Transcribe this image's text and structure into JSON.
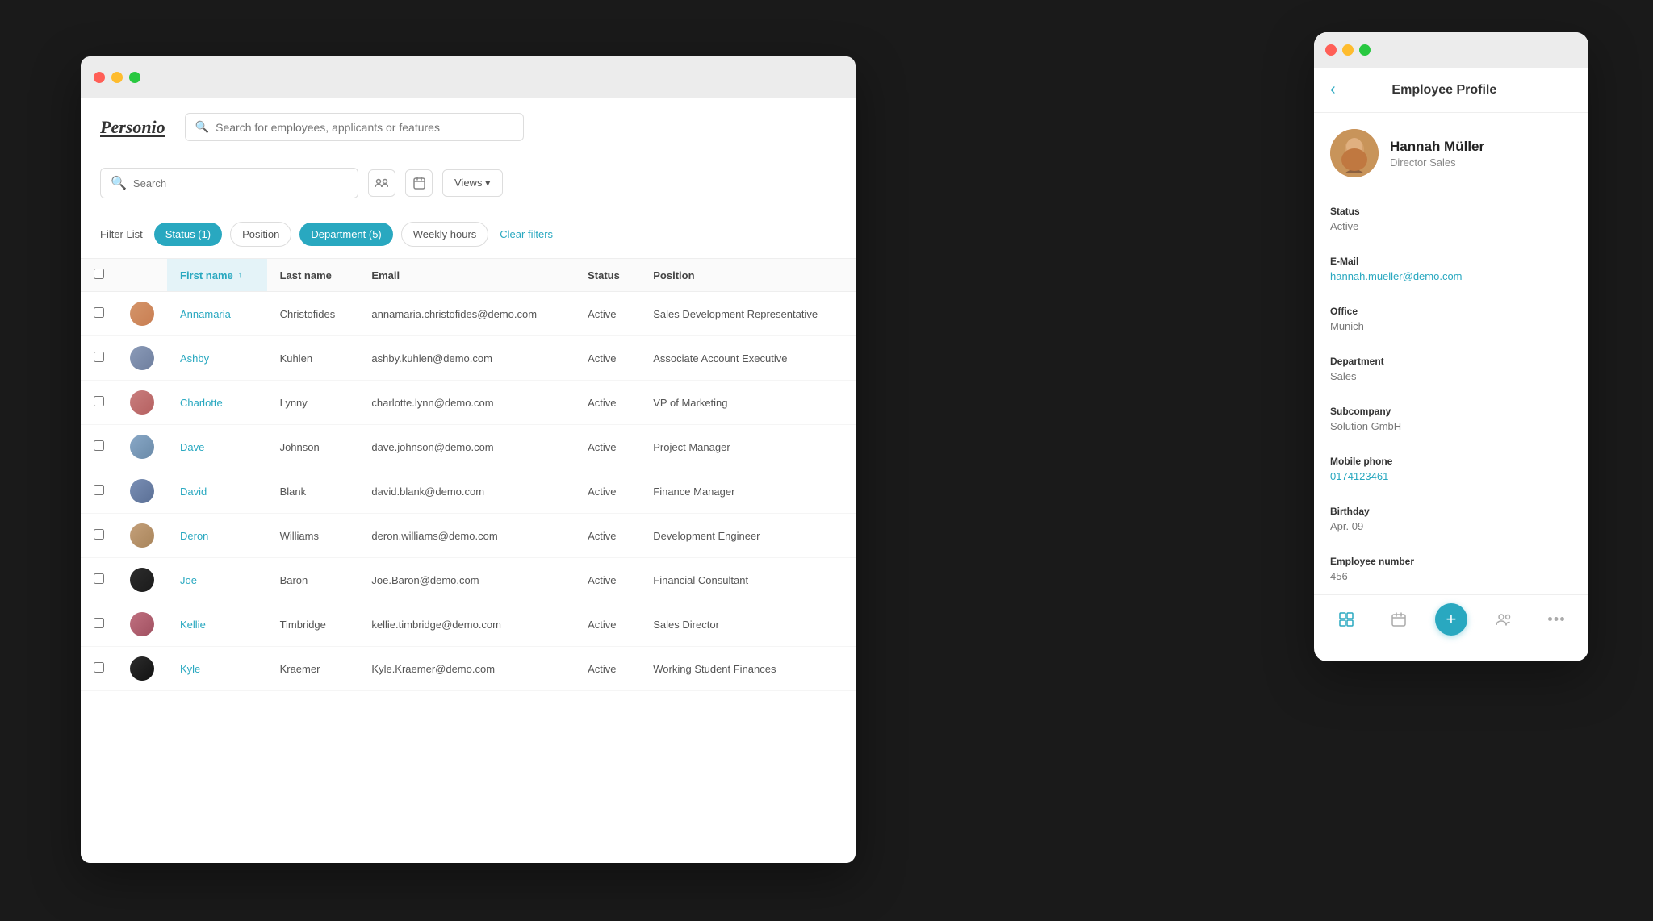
{
  "app": {
    "title": "Personio"
  },
  "global_search": {
    "placeholder": "Search for employees, applicants or features"
  },
  "toolbar": {
    "search_placeholder": "Search",
    "views_label": "Views ▾"
  },
  "filter_bar": {
    "label": "Filter List",
    "filters": [
      {
        "id": "status",
        "label": "Status (1)",
        "active": true
      },
      {
        "id": "position",
        "label": "Position",
        "active": false
      },
      {
        "id": "department",
        "label": "Department (5)",
        "active": true
      },
      {
        "id": "weekly_hours",
        "label": "Weekly hours",
        "active": false
      }
    ],
    "clear_label": "Clear filters"
  },
  "table": {
    "columns": [
      "",
      "",
      "First name",
      "Last name",
      "Email",
      "Status",
      "Position"
    ],
    "rows": [
      {
        "id": 1,
        "avatar_class": "avatar-1",
        "first_name": "Annamaria",
        "last_name": "Christofides",
        "email": "annamaria.christofides@demo.com",
        "status": "Active",
        "position": "Sales Development Representative"
      },
      {
        "id": 2,
        "avatar_class": "avatar-2",
        "first_name": "Ashby",
        "last_name": "Kuhlen",
        "email": "ashby.kuhlen@demo.com",
        "status": "Active",
        "position": "Associate Account Executive"
      },
      {
        "id": 3,
        "avatar_class": "avatar-3",
        "first_name": "Charlotte",
        "last_name": "Lynny",
        "email": "charlotte.lynn@demo.com",
        "status": "Active",
        "position": "VP of Marketing"
      },
      {
        "id": 4,
        "avatar_class": "avatar-4",
        "first_name": "Dave",
        "last_name": "Johnson",
        "email": "dave.johnson@demo.com",
        "status": "Active",
        "position": "Project Manager"
      },
      {
        "id": 5,
        "avatar_class": "avatar-5",
        "first_name": "David",
        "last_name": "Blank",
        "email": "david.blank@demo.com",
        "status": "Active",
        "position": "Finance Manager"
      },
      {
        "id": 6,
        "avatar_class": "avatar-6",
        "first_name": "Deron",
        "last_name": "Williams",
        "email": "deron.williams@demo.com",
        "status": "Active",
        "position": "Development Engineer"
      },
      {
        "id": 7,
        "avatar_class": "avatar-7",
        "first_name": "Joe",
        "last_name": "Baron",
        "email": "Joe.Baron@demo.com",
        "status": "Active",
        "position": "Financial Consultant"
      },
      {
        "id": 8,
        "avatar_class": "avatar-8",
        "first_name": "Kellie",
        "last_name": "Timbridge",
        "email": "kellie.timbridge@demo.com",
        "status": "Active",
        "position": "Sales Director"
      },
      {
        "id": 9,
        "avatar_class": "avatar-9",
        "first_name": "Kyle",
        "last_name": "Kraemer",
        "email": "Kyle.Kraemer@demo.com",
        "status": "Active",
        "position": "Working Student Finances"
      }
    ]
  },
  "profile": {
    "title": "Employee Profile",
    "employee": {
      "name": "Hannah Müller",
      "role": "Director Sales"
    },
    "fields": [
      {
        "label": "Status",
        "value": "Active",
        "is_link": false
      },
      {
        "label": "E-Mail",
        "value": "hannah.mueller@demo.com",
        "is_link": true
      },
      {
        "label": "Office",
        "value": "Munich",
        "is_link": false
      },
      {
        "label": "Department",
        "value": "Sales",
        "is_link": false
      },
      {
        "label": "Subcompany",
        "value": "Solution GmbH",
        "is_link": false
      },
      {
        "label": "Mobile phone",
        "value": "0174123461",
        "is_link": true
      },
      {
        "label": "Birthday",
        "value": "Apr. 09",
        "is_link": false
      },
      {
        "label": "Employee number",
        "value": "456",
        "is_link": false
      }
    ]
  },
  "colors": {
    "accent": "#29a8c0",
    "active_filter_bg": "#29a8c0",
    "link_color": "#29a8c0"
  }
}
